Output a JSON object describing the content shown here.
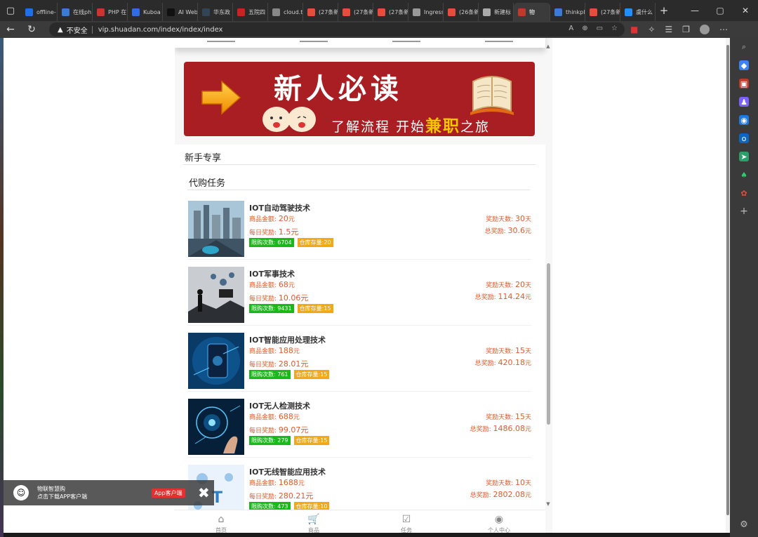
{
  "browser": {
    "tabs": [
      {
        "title": "offline-",
        "color": "#1f6feb"
      },
      {
        "title": "在线ph",
        "color": "#3a7bd5"
      },
      {
        "title": "PHP 在",
        "color": "#c33"
      },
      {
        "title": "Kuboa",
        "color": "#326ce5"
      },
      {
        "title": "AI Web",
        "color": "#111"
      },
      {
        "title": "华东政",
        "color": "#345"
      },
      {
        "title": "五院四",
        "color": "#c22"
      },
      {
        "title": "cloud.t",
        "color": "#888"
      },
      {
        "title": "(27条新",
        "color": "#e74c3c"
      },
      {
        "title": "(27条新",
        "color": "#e74c3c"
      },
      {
        "title": "(27条新",
        "color": "#e74c3c"
      },
      {
        "title": "Ingress",
        "color": "#999"
      },
      {
        "title": "(26条新",
        "color": "#e74c3c"
      },
      {
        "title": "新建标",
        "color": "#aaa"
      },
      {
        "title": "物",
        "color": "#c0392b",
        "active": true
      },
      {
        "title": "thinkpl",
        "color": "#3a7bd5"
      },
      {
        "title": "(27条新",
        "color": "#e74c3c"
      },
      {
        "title": "虞什么",
        "color": "#1e90ff"
      }
    ],
    "security_label": "不安全",
    "url": "vip.shuadan.com/index/index/index"
  },
  "banner": {
    "headline": "新人必读",
    "tagline_before": "了解流程 开始",
    "tagline_highlight": "兼职",
    "tagline_after": "之旅",
    "bg_color": "#a81e22"
  },
  "section": {
    "title": "新手专享",
    "subtitle": "代购任务"
  },
  "labels": {
    "amount": "商品金额:",
    "daily": "每日奖励:",
    "days": "奖励天数:",
    "total": "总奖励:",
    "yuan": "元",
    "day_unit": "天",
    "limit": "限购次数:",
    "stock": "仓库存量:"
  },
  "items": [
    {
      "name": "IOT自动驾驶技术",
      "amount": "20",
      "daily": "1.5",
      "days": "30",
      "total": "30.6",
      "limit": "6704",
      "stock": "20",
      "img": "city"
    },
    {
      "name": "IOT军事技术",
      "amount": "68",
      "daily": "10.06",
      "days": "20",
      "total": "114.24",
      "limit": "9431",
      "stock": "15",
      "img": "military"
    },
    {
      "name": "IOT智能应用处理技术",
      "amount": "188",
      "daily": "28.01",
      "days": "15",
      "total": "420.18",
      "limit": "761",
      "stock": "15",
      "img": "phone"
    },
    {
      "name": "IOT无人检测技术",
      "amount": "688",
      "daily": "99.07",
      "days": "15",
      "total": "1486.08",
      "limit": "279",
      "stock": "15",
      "img": "hand"
    },
    {
      "name": "IOT无线智能应用技术",
      "amount": "1688",
      "daily": "280.21",
      "days": "10",
      "total": "2802.08",
      "limit": "473",
      "stock": "10",
      "img": "iot"
    }
  ],
  "popup": {
    "app_name": "物联智慧购",
    "app_desc": "点击下载APP客户端",
    "download_label": "App客户端"
  },
  "bottom_nav": [
    {
      "icon": "home-icon",
      "label": "首页"
    },
    {
      "icon": "cart-icon",
      "label": "商品"
    },
    {
      "icon": "task-icon",
      "label": "任务"
    },
    {
      "icon": "user-icon",
      "label": "个人中心"
    }
  ]
}
